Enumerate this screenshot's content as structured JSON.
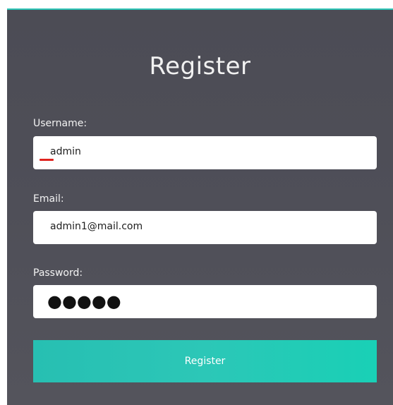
{
  "form": {
    "title": "Register",
    "username": {
      "label": "Username:",
      "value": "admin"
    },
    "email": {
      "label": "Email:",
      "value": "admin1@mail.com"
    },
    "password": {
      "label": "Password:",
      "masked_value": "●●●●●"
    },
    "submit_label": "Register"
  },
  "colors": {
    "panel_bg": "#4f4f58",
    "accent": "#2ec4b6",
    "caret_mark": "#e0241f"
  }
}
